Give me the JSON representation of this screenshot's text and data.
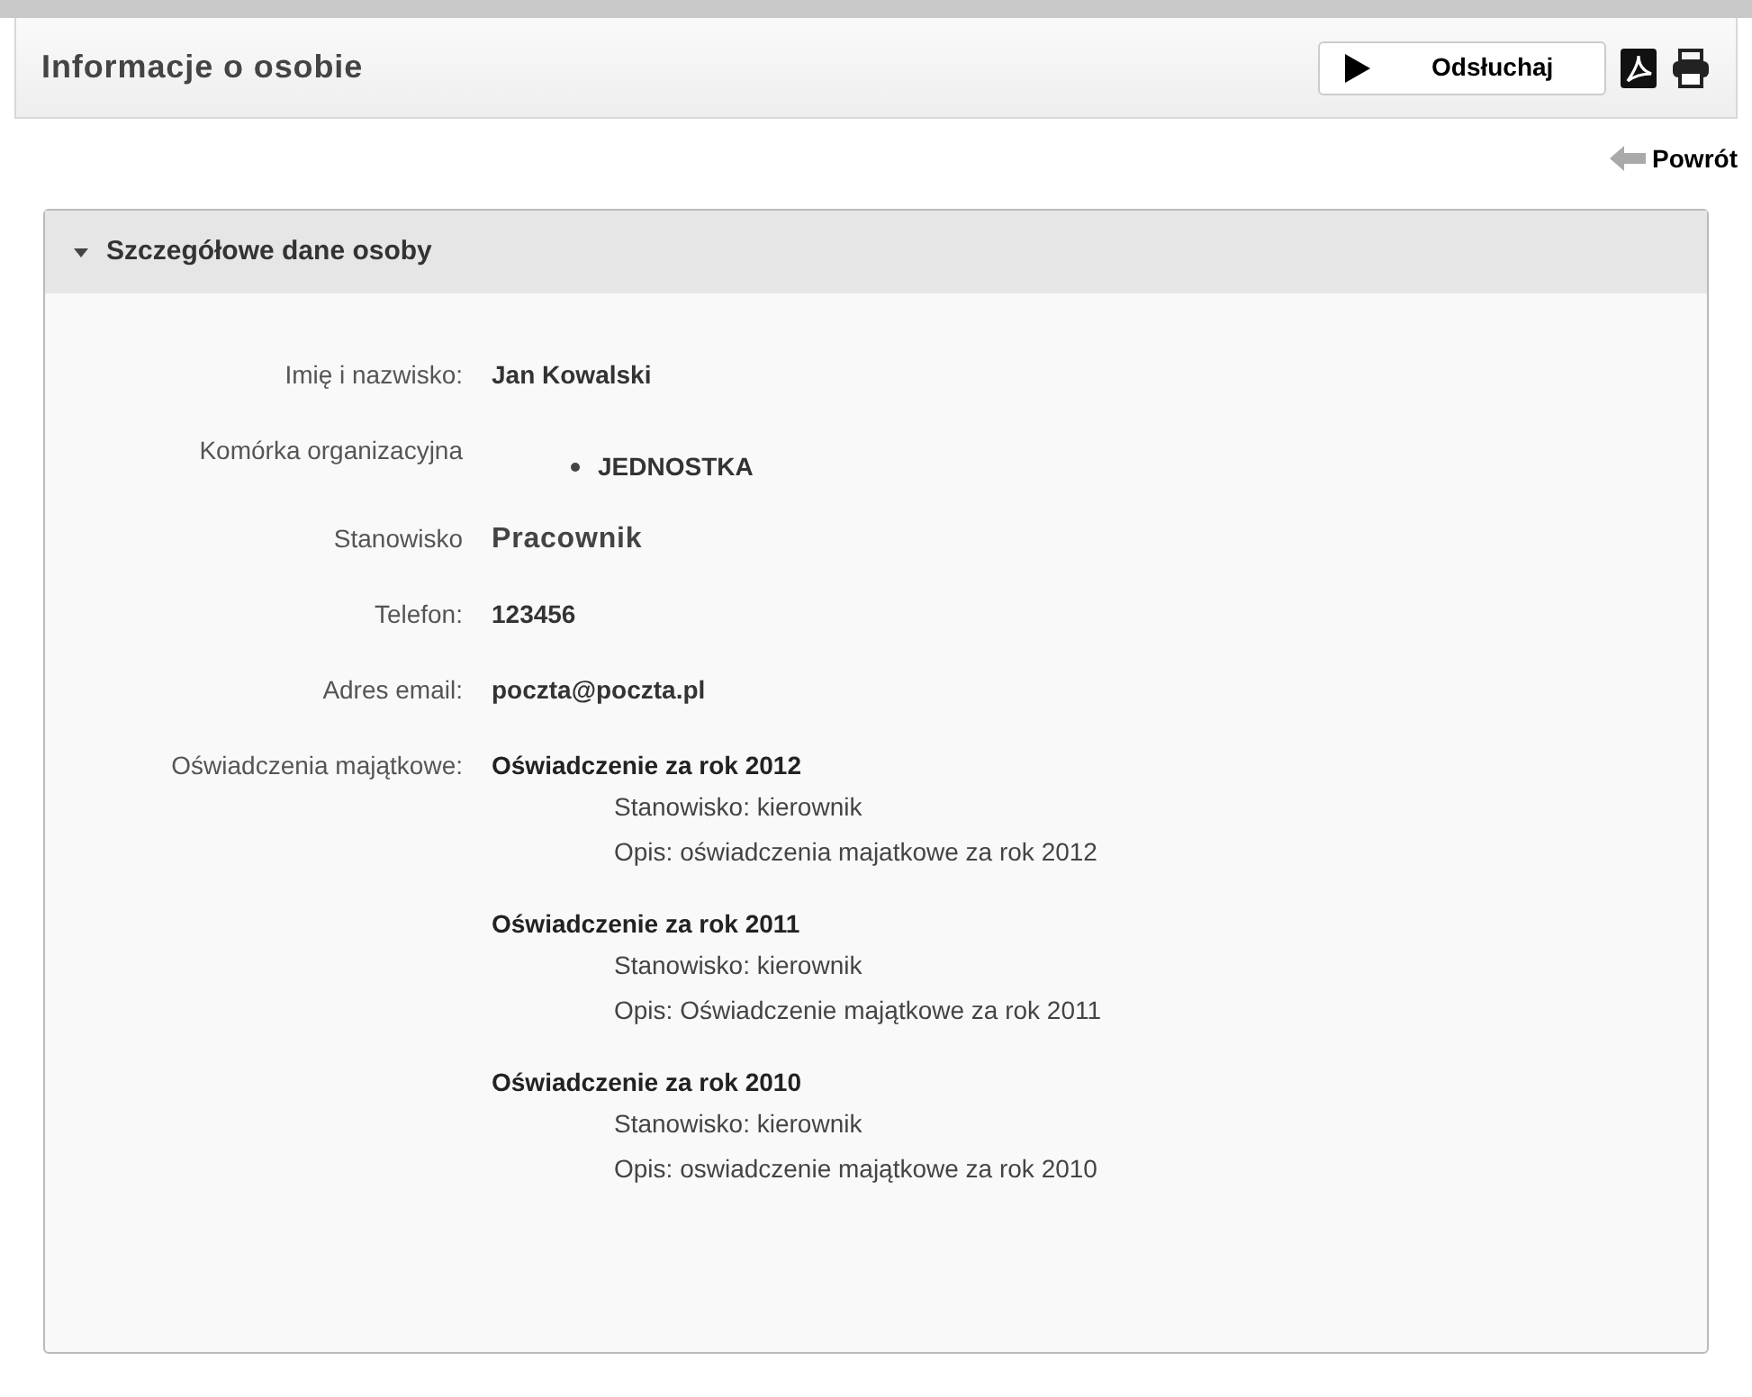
{
  "header": {
    "title": "Informacje o osobie",
    "listen_button": "Odsłuchaj"
  },
  "back_link": "Powrót",
  "panel": {
    "title": "Szczegółowe dane osoby",
    "expanded": true,
    "fields": [
      {
        "kind": "text",
        "label": "Imię i nazwisko:",
        "value": "Jan Kowalski"
      },
      {
        "kind": "list",
        "label": "Komórka organizacyjna",
        "items": [
          "JEDNOSTKA"
        ]
      },
      {
        "kind": "large",
        "label": "Stanowisko",
        "value": "Pracownik"
      },
      {
        "kind": "text",
        "label": "Telefon:",
        "value": "123456"
      },
      {
        "kind": "text",
        "label": "Adres email:",
        "value": "poczta@poczta.pl"
      },
      {
        "kind": "statements",
        "label": "Oświadczenia majątkowe:",
        "items": [
          {
            "title": "Oświadczenie za rok 2012",
            "position": "Stanowisko: kierownik",
            "description": "Opis: oświadczenia majatkowe za rok 2012"
          },
          {
            "title": "Oświadczenie za rok 2011",
            "position": "Stanowisko: kierownik",
            "description": "Opis: Oświadczenie majątkowe za rok 2011"
          },
          {
            "title": "Oświadczenie za rok 2010",
            "position": "Stanowisko: kierownik",
            "description": "Opis: oswiadczenie majątkowe za rok 2010"
          }
        ]
      }
    ]
  }
}
